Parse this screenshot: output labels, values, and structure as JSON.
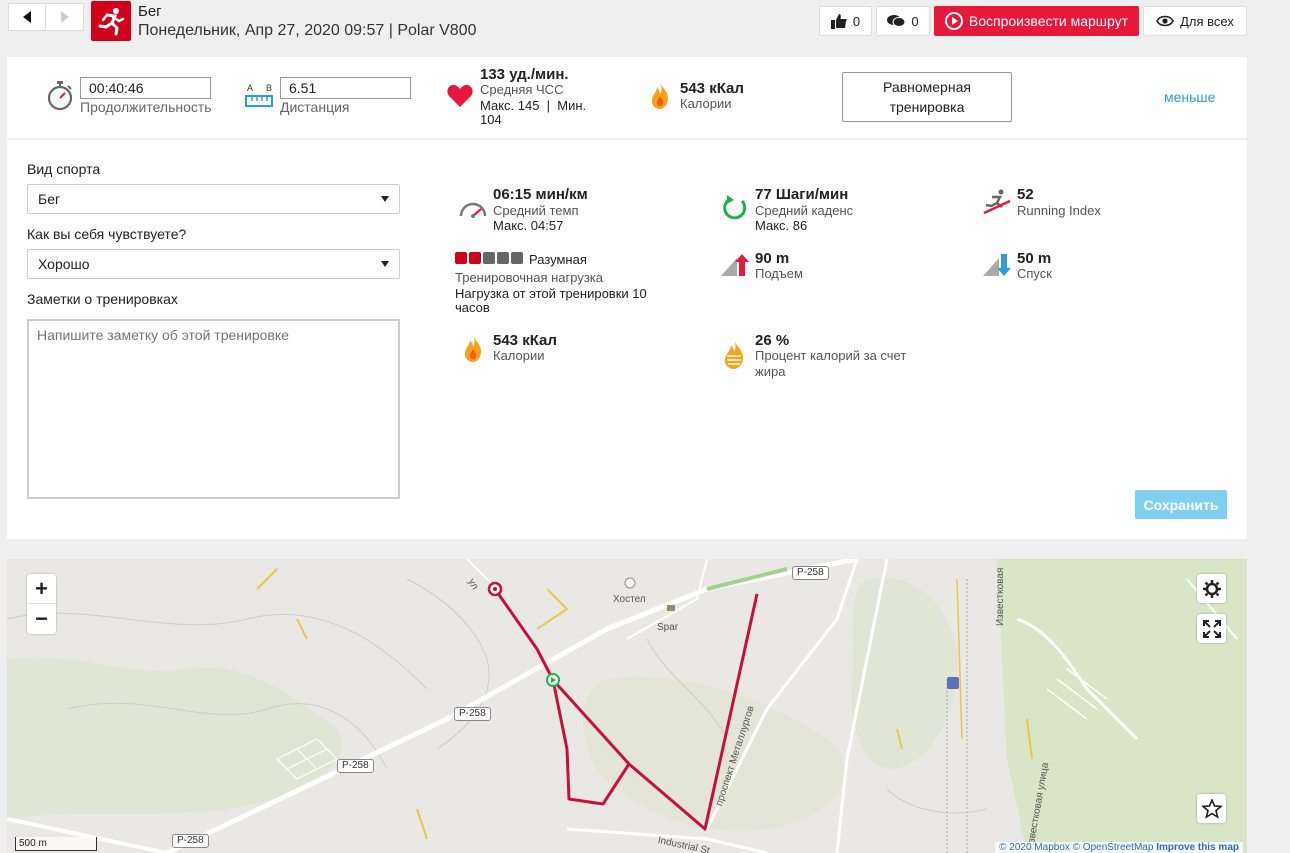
{
  "header": {
    "sport_title": "Бег",
    "subtitle": "Понедельник, Апр 27, 2020 09:57 | Polar V800",
    "likes": "0",
    "comments": "0",
    "play_route": "Воспроизвести маршрут",
    "visibility": "Для всех"
  },
  "summary": {
    "duration_value": "00:40:46",
    "duration_label": "Продолжительность",
    "distance_a": "A",
    "distance_b": "B",
    "distance_value": "6.51",
    "distance_label": "Дистанция",
    "hr_value": "133 уд./мин.",
    "hr_label": "Средняя ЧСС",
    "hr_max_min": "Макс. 145  |  Мин.",
    "hr_min_value": "104",
    "calories_value": "543 кКал",
    "calories_label": "Калории",
    "training_type_line1": "Равномерная",
    "training_type_line2": "тренировка",
    "less_link": "меньше"
  },
  "form": {
    "sport_label": "Вид спорта",
    "sport_value": "Бег",
    "feeling_label": "Как вы себя чувствуете?",
    "feeling_value": "Хорошо",
    "notes_label": "Заметки о тренировках",
    "notes_placeholder": "Напишите заметку об этой тренировке",
    "save": "Сохранить"
  },
  "stats": {
    "pace_value": "06:15 мин/км",
    "pace_label": "Средний темп",
    "pace_max": "Макс. 04:57",
    "cadence_value": "77 Шаги/мин",
    "cadence_label": "Средний каденс",
    "cadence_max": "Макс. 86",
    "running_index_value": "52",
    "running_index_label": "Running Index",
    "load_level": "Разумная",
    "load_label": "Тренировочная нагрузка",
    "load_desc_line1": "Нагрузка от этой тренировки 10",
    "load_desc_line2": "часов",
    "ascent_value": "90 m",
    "ascent_label": "Подъем",
    "descent_value": "50 m",
    "descent_label": "Спуск",
    "calories_value": "543 кКал",
    "calories_label": "Калории",
    "fat_value": "26 %",
    "fat_label_line1": "Процент калорий за счет",
    "fat_label_line2": "жира"
  },
  "map": {
    "zoom_in": "+",
    "zoom_out": "−",
    "road_p258": "P-258",
    "hostel": "Хостел",
    "spar": "Spar",
    "street_metallurgov": "проспект Металлургов",
    "street_izvestkovaya": "Известковая",
    "street_izvestkovaya2": "Известковая улица",
    "street_industrial": "Industrial St",
    "street_ul": "ул",
    "scale": "500 m",
    "attribution_1": "© 2020 Mapbox",
    "attribution_2": "© OpenStreetMap",
    "attribution_3": "Improve this map"
  },
  "colors": {
    "accent_red": "#e8173c",
    "route": "#c8103c",
    "save_blue": "#7fcff0",
    "link_blue": "#2a9fd6"
  }
}
